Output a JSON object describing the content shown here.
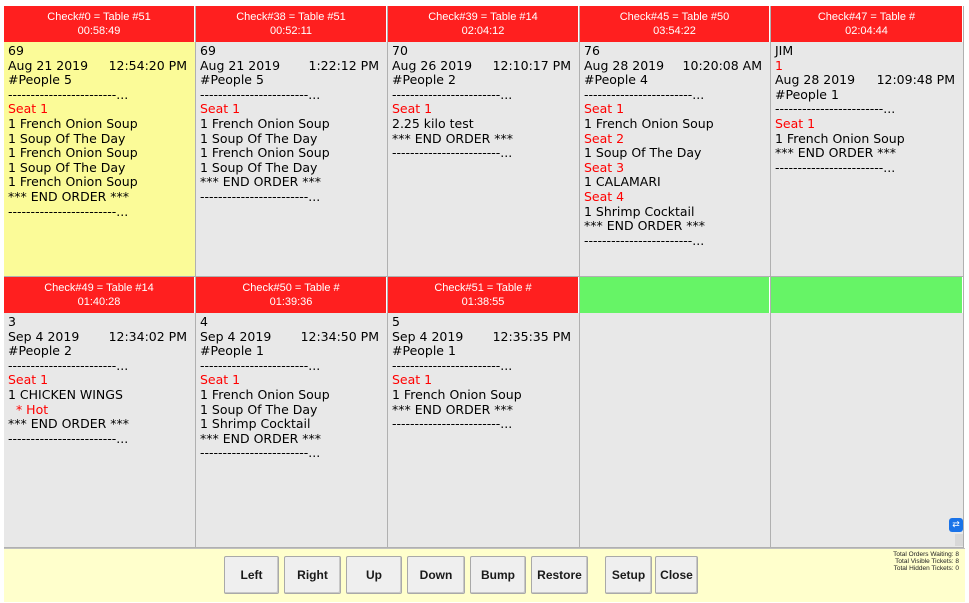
{
  "tickets": [
    {
      "title": "Check#0 = Table #51",
      "time": "00:58:49",
      "lines": [
        {
          "t": "69"
        },
        {
          "date": "Aug 21 2019",
          "clock": "12:54:20 PM"
        },
        {
          "t": "#People 5"
        },
        {
          "t": "------------------------...",
          "dash": true
        },
        {
          "t": "Seat 1",
          "red": true
        },
        {
          "t": "1 French Onion Soup"
        },
        {
          "t": "1 Soup Of The Day"
        },
        {
          "t": "1 French Onion Soup"
        },
        {
          "t": "1 Soup Of The Day"
        },
        {
          "t": "1 French Onion Soup"
        },
        {
          "t": "*** END ORDER ***"
        },
        {
          "t": "------------------------...",
          "dash": true
        }
      ]
    },
    {
      "title": "Check#38 = Table #51",
      "time": "00:52:11",
      "lines": [
        {
          "t": "69"
        },
        {
          "date": "Aug 21 2019",
          "clock": "1:22:12 PM"
        },
        {
          "t": "#People 5"
        },
        {
          "t": "------------------------...",
          "dash": true
        },
        {
          "t": "Seat 1",
          "red": true
        },
        {
          "t": "1 French Onion Soup"
        },
        {
          "t": "1 Soup Of The Day"
        },
        {
          "t": "1 French Onion Soup"
        },
        {
          "t": "1 Soup Of The Day"
        },
        {
          "t": "*** END ORDER ***"
        },
        {
          "t": "------------------------...",
          "dash": true
        }
      ]
    },
    {
      "title": "Check#39 = Table #14",
      "time": "02:04:12",
      "lines": [
        {
          "t": "70"
        },
        {
          "date": "Aug 26 2019",
          "clock": "12:10:17 PM"
        },
        {
          "t": "#People 2"
        },
        {
          "t": "------------------------...",
          "dash": true
        },
        {
          "t": "Seat 1",
          "red": true
        },
        {
          "t": "2.25 kilo test"
        },
        {
          "t": "*** END ORDER ***"
        },
        {
          "t": "------------------------...",
          "dash": true
        }
      ]
    },
    {
      "title": "Check#45 = Table #50",
      "time": "03:54:22",
      "lines": [
        {
          "t": "76"
        },
        {
          "date": "Aug 28 2019",
          "clock": "10:20:08 AM"
        },
        {
          "t": "#People 4"
        },
        {
          "t": "------------------------...",
          "dash": true
        },
        {
          "t": "Seat 1",
          "red": true
        },
        {
          "t": "1 French Onion Soup"
        },
        {
          "t": "Seat 2",
          "red": true
        },
        {
          "t": "1 Soup Of The Day"
        },
        {
          "t": "Seat 3",
          "red": true
        },
        {
          "t": "1 CALAMARI"
        },
        {
          "t": "Seat 4",
          "red": true
        },
        {
          "t": "1 Shrimp Cocktail"
        },
        {
          "t": "*** END ORDER ***"
        },
        {
          "t": "------------------------...",
          "dash": true
        }
      ]
    },
    {
      "title": "Check#47 = Table #",
      "time": "02:04:44",
      "lines": [
        {
          "t": "JIM"
        },
        {
          "t": "1",
          "red": true
        },
        {
          "date": "Aug 28 2019",
          "clock": "12:09:48 PM"
        },
        {
          "t": "#People 1"
        },
        {
          "t": "------------------------...",
          "dash": true
        },
        {
          "t": "Seat 1",
          "red": true
        },
        {
          "t": "1 French Onion Soup"
        },
        {
          "t": "*** END ORDER ***"
        },
        {
          "t": "------------------------...",
          "dash": true
        }
      ]
    },
    {
      "title": "Check#49 = Table #14",
      "time": "01:40:28",
      "lines": [
        {
          "t": "3"
        },
        {
          "date": "Sep 4 2019",
          "clock": "12:34:02 PM"
        },
        {
          "t": "#People 2"
        },
        {
          "t": "------------------------...",
          "dash": true
        },
        {
          "t": "Seat 1",
          "red": true
        },
        {
          "t": "1 CHICKEN WINGS"
        },
        {
          "t": "  * Hot",
          "red": true
        },
        {
          "t": "*** END ORDER ***"
        },
        {
          "t": "------------------------...",
          "dash": true
        }
      ]
    },
    {
      "title": "Check#50 = Table #",
      "time": "01:39:36",
      "lines": [
        {
          "t": "4"
        },
        {
          "date": "Sep 4 2019",
          "clock": "12:34:50 PM"
        },
        {
          "t": "#People 1"
        },
        {
          "t": "------------------------...",
          "dash": true
        },
        {
          "t": "Seat 1",
          "red": true
        },
        {
          "t": "1 French Onion Soup"
        },
        {
          "t": "1 Soup Of The Day"
        },
        {
          "t": "1 Shrimp Cocktail"
        },
        {
          "t": "*** END ORDER ***"
        },
        {
          "t": "------------------------...",
          "dash": true
        }
      ]
    },
    {
      "title": "Check#51 = Table #",
      "time": "01:38:55",
      "lines": [
        {
          "t": "5"
        },
        {
          "date": "Sep 4 2019",
          "clock": "12:35:35 PM"
        },
        {
          "t": "#People 1"
        },
        {
          "t": "------------------------...",
          "dash": true
        },
        {
          "t": "Seat 1",
          "red": true
        },
        {
          "t": "1 French Onion Soup"
        },
        {
          "t": "*** END ORDER ***"
        },
        {
          "t": "------------------------...",
          "dash": true
        }
      ]
    },
    {
      "title": "",
      "time": "",
      "empty": true,
      "lines": []
    },
    {
      "title": "",
      "time": "",
      "empty": true,
      "lines": []
    }
  ],
  "buttons": [
    {
      "label": "Left",
      "name": "left-button"
    },
    {
      "label": "Right",
      "name": "right-button"
    },
    {
      "label": "Up",
      "name": "up-button"
    },
    {
      "label": "Down",
      "name": "down-button"
    },
    {
      "label": "Bump",
      "name": "bump-button"
    },
    {
      "label": "Restore",
      "name": "restore-button"
    },
    {
      "label": "Setup",
      "name": "setup-button"
    },
    {
      "label": "Close",
      "name": "close-button"
    }
  ],
  "stats": {
    "waiting": "Total Orders Waiting:  8",
    "visible": "Total Visible Tickets:  8",
    "hidden": "Total Hidden Tickets:  0"
  },
  "colors": {
    "header": "#ff1f1f",
    "empty_header": "#66f466",
    "highlight": "#fbfb98",
    "seat": "#ff0000"
  }
}
